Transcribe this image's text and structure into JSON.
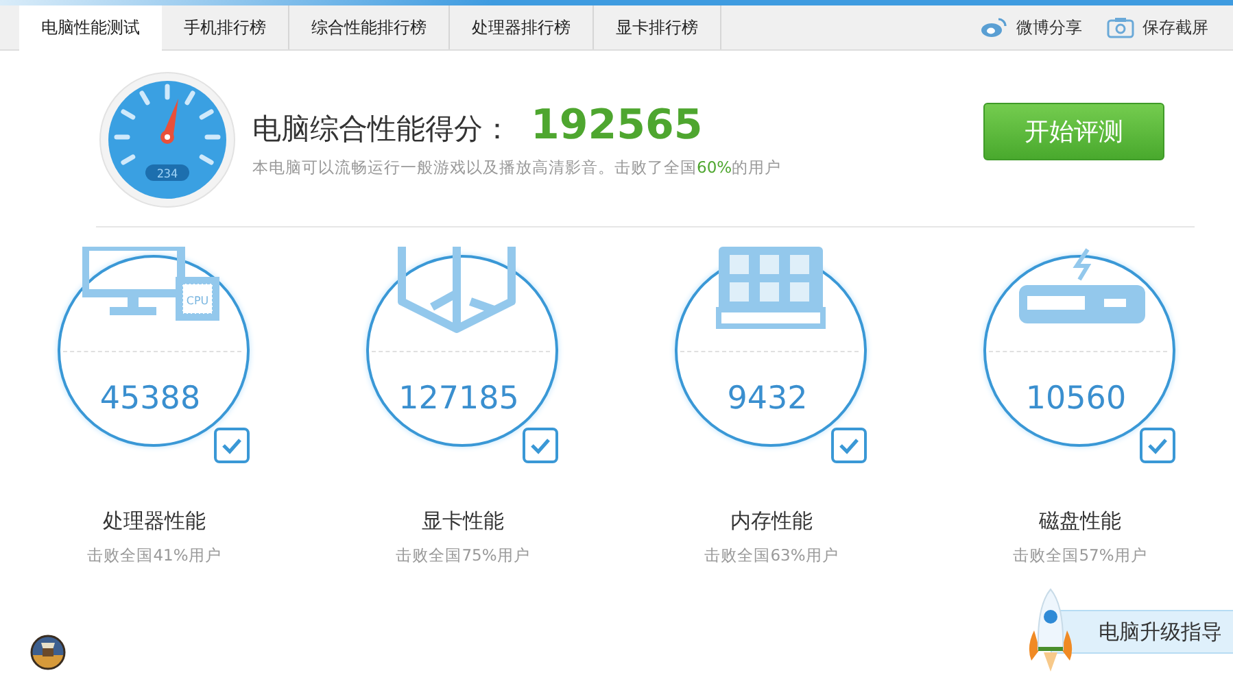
{
  "tabs": [
    {
      "label": "电脑性能测试",
      "selected": true
    },
    {
      "label": "手机排行榜",
      "selected": false
    },
    {
      "label": "综合性能排行榜",
      "selected": false
    },
    {
      "label": "处理器排行榜",
      "selected": false
    },
    {
      "label": "显卡排行榜",
      "selected": false
    }
  ],
  "actions": [
    {
      "kind": "weibo",
      "label": "微博分享"
    },
    {
      "kind": "camera",
      "label": "保存截屏"
    }
  ],
  "summary": {
    "gauge_display": "234",
    "title": "电脑综合性能得分：",
    "score": "192565",
    "description": "本电脑可以流畅运行一般游戏以及播放高清影音。击败了全国**60%**的用户",
    "button": "开始评测"
  },
  "components": [
    {
      "kind": "cpu",
      "chip_label": "CPU",
      "score": "45388",
      "checked": true,
      "name": "处理器性能",
      "rank": "击败全国41%用户"
    },
    {
      "kind": "gpu",
      "score": "127185",
      "checked": true,
      "name": "显卡性能",
      "rank": "击败全国75%用户"
    },
    {
      "kind": "memory",
      "score": "9432",
      "checked": true,
      "name": "内存性能",
      "rank": "击败全国63%用户"
    },
    {
      "kind": "disk",
      "score": "10560",
      "checked": true,
      "name": "磁盘性能",
      "rank": "击败全国57%用户"
    }
  ],
  "upgrade_guide": {
    "label": "电脑升级指导"
  }
}
